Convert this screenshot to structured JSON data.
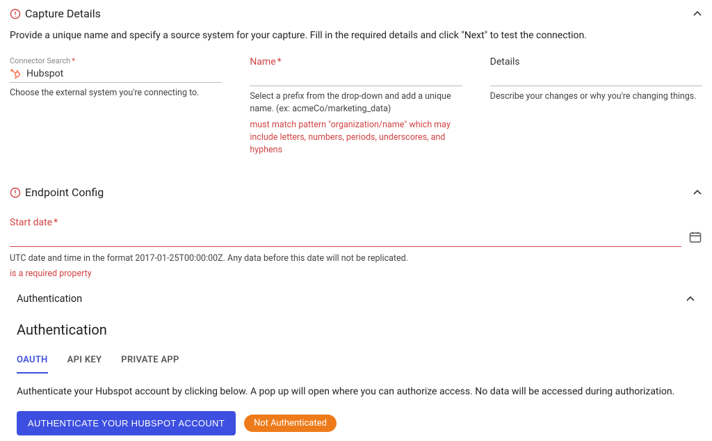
{
  "captureDetails": {
    "title": "Capture Details",
    "description": "Provide a unique name and specify a source system for your capture. Fill in the required details and click \"Next\" to test the connection.",
    "connector": {
      "label": "Connector Search",
      "required": "*",
      "value": "Hubspot",
      "hint": "Choose the external system you're connecting to."
    },
    "name": {
      "label": "Name",
      "required": "*",
      "hint": "Select a prefix from the drop-down and add a unique name. (ex: acmeCo/marketing_data)",
      "error": "must match pattern \"organization/name\" which may include letters, numbers, periods, underscores, and hyphens"
    },
    "details": {
      "label": "Details",
      "hint": "Describe your changes or why you're changing things."
    }
  },
  "endpointConfig": {
    "title": "Endpoint Config",
    "startDate": {
      "label": "Start date",
      "required": "*",
      "hint": "UTC date and time in the format 2017-01-25T00:00:00Z. Any data before this date will not be replicated.",
      "error": "is a required property"
    },
    "authSection": {
      "title": "Authentication"
    }
  },
  "auth": {
    "heading": "Authentication",
    "tabs": {
      "oauth": "OAUTH",
      "apiKey": "API KEY",
      "privateApp": "PRIVATE APP"
    },
    "description": "Authenticate your Hubspot account by clicking below. A pop up will open where you can authorize access. No data will be accessed during authorization.",
    "button": "AUTHENTICATE YOUR HUBSPOT ACCOUNT",
    "status": "Not Authenticated"
  }
}
